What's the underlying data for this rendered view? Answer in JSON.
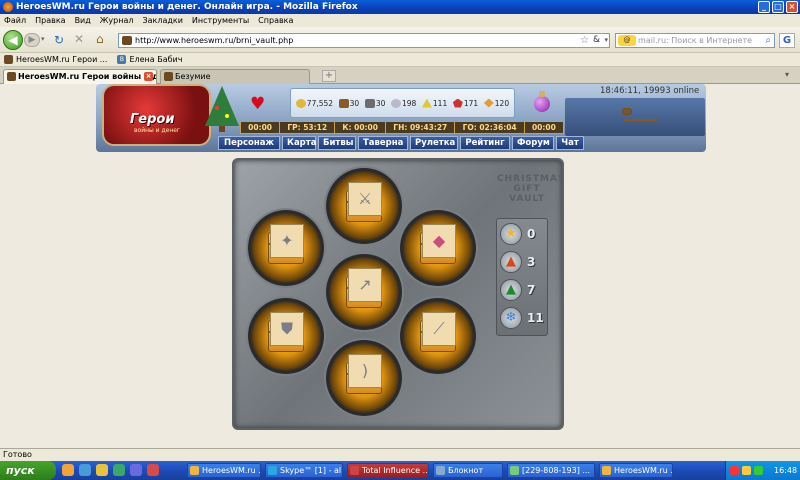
{
  "window": {
    "title": "HeroesWM.ru Герои войны и денег. Онлайн игра. - Mozilla Firefox"
  },
  "menu": [
    "Файл",
    "Правка",
    "Вид",
    "Журнал",
    "Закладки",
    "Инструменты",
    "Справка"
  ],
  "navbar": {
    "url": "http://www.heroeswm.ru/brni_vault.php",
    "search_placeholder": "mail.ru: Поиск в Интернете",
    "search_engine": "@"
  },
  "bookmarks": [
    {
      "label": "HeroesWM.ru Герои ...",
      "icon": "heroes-favicon"
    },
    {
      "label": "Елена Бабич",
      "icon": "vk-favicon"
    }
  ],
  "tabs": [
    {
      "label": "HeroesWM.ru Герои войны и ден...",
      "active": true
    },
    {
      "label": "Безумие",
      "active": false
    }
  ],
  "game": {
    "logo_title": "Герои",
    "logo_subtitle": "войны и денег",
    "resources": [
      {
        "name": "gold",
        "value": "77,552"
      },
      {
        "name": "wood",
        "value": "30"
      },
      {
        "name": "ore",
        "value": "30"
      },
      {
        "name": "mercury",
        "value": "198"
      },
      {
        "name": "sulfur",
        "value": "111"
      },
      {
        "name": "crystal",
        "value": "171"
      },
      {
        "name": "gems",
        "value": "120"
      }
    ],
    "timers": [
      "00:00",
      "ГР: 53:12",
      "К: 00:00",
      "ГН: 09:43:27",
      "ГО: 02:36:04",
      "00:00"
    ],
    "server_time": "18:46:11, 19993 online",
    "nav": [
      "Персонаж",
      "Карта",
      "Битвы",
      "Таверна",
      "Рулетка",
      "Рейтинг",
      "Форум",
      "Чат"
    ],
    "vault": {
      "title_line1": "CHRISTMAS",
      "title_line2": "GIFT VAULT",
      "items": [
        {
          "slot": "top",
          "item": "sword-icon"
        },
        {
          "slot": "upper-left",
          "item": "magic-staff-icon"
        },
        {
          "slot": "upper-right",
          "item": "candy-icon"
        },
        {
          "slot": "center",
          "item": "spear-icon"
        },
        {
          "slot": "lower-left",
          "item": "armor-icon"
        },
        {
          "slot": "lower-right",
          "item": "wand-icon"
        },
        {
          "slot": "bottom",
          "item": "bow-icon"
        }
      ],
      "counters": [
        {
          "icon": "star-icon",
          "glyph": "★",
          "color": "#f2b820",
          "value": "0"
        },
        {
          "icon": "bell-icon",
          "glyph": "🔔",
          "color": "#d9481b",
          "value": "3"
        },
        {
          "icon": "christmas-tree-icon",
          "glyph": "▲",
          "color": "#1e8a2d",
          "value": "7"
        },
        {
          "icon": "snowflake-icon",
          "glyph": "❄",
          "color": "#3b78d8",
          "value": "11"
        }
      ]
    }
  },
  "status": "Готово",
  "taskbar": {
    "start_label": "пуск",
    "buttons": [
      {
        "label": "HeroesWM.ru ...",
        "active": false
      },
      {
        "label": "Skype™ [1] - al...",
        "active": false
      },
      {
        "label": "Total Influence ...",
        "active": true
      },
      {
        "label": "Блокнот",
        "active": false
      },
      {
        "label": "[229-808-193] ...",
        "active": false
      },
      {
        "label": "HeroesWM.ru ...",
        "active": false
      }
    ],
    "clock": "16:48"
  }
}
